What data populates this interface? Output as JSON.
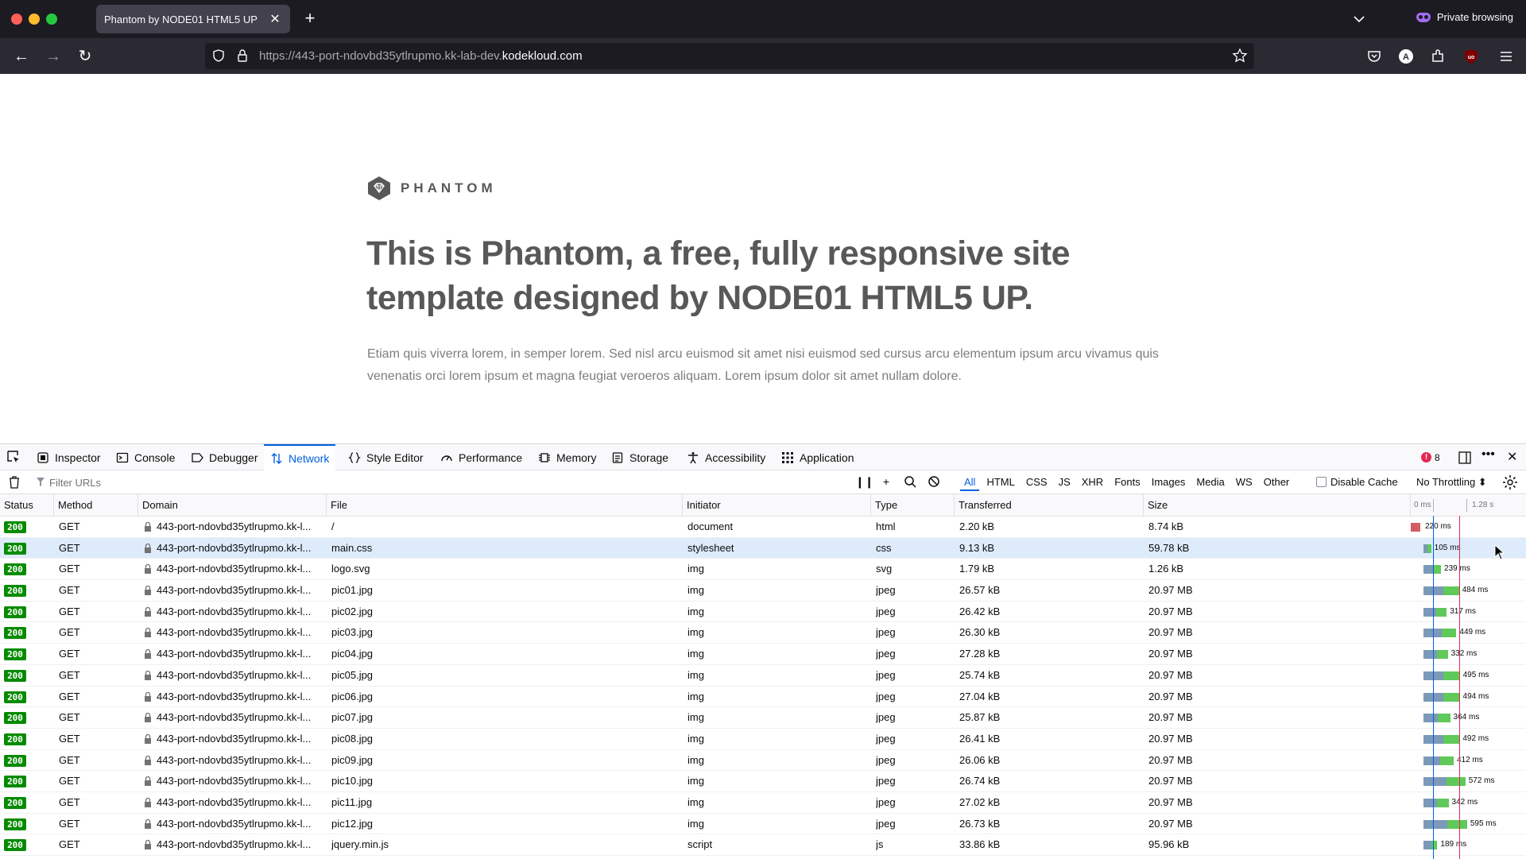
{
  "browser": {
    "tab_title": "Phantom by NODE01 HTML5 UP",
    "url_prefix": "https://443-port-ndovbd35ytlrupmo.kk-lab-dev.",
    "url_host": "kodekloud.com",
    "private_label": "Private browsing"
  },
  "page": {
    "logo_text": "PHANTOM",
    "headline": "This is Phantom, a free, fully responsive site template designed by NODE01 HTML5 UP.",
    "paragraph": "Etiam quis viverra lorem, in semper lorem. Sed nisl arcu euismod sit amet nisi euismod sed cursus arcu elementum ipsum arcu vivamus quis venenatis orci lorem ipsum et magna feugiat veroeros aliquam. Lorem ipsum dolor sit amet nullam dolore."
  },
  "devtools": {
    "tabs": [
      {
        "label": "Inspector",
        "icon": "inspector-icon"
      },
      {
        "label": "Console",
        "icon": "console-icon"
      },
      {
        "label": "Debugger",
        "icon": "debugger-icon"
      },
      {
        "label": "Network",
        "icon": "network-icon",
        "active": true
      },
      {
        "label": "Style Editor",
        "icon": "style-editor-icon"
      },
      {
        "label": "Performance",
        "icon": "performance-icon"
      },
      {
        "label": "Memory",
        "icon": "memory-icon"
      },
      {
        "label": "Storage",
        "icon": "storage-icon"
      },
      {
        "label": "Accessibility",
        "icon": "accessibility-icon"
      },
      {
        "label": "Application",
        "icon": "application-icon"
      }
    ],
    "error_count": "8",
    "filter_placeholder": "Filter URLs",
    "type_filters": [
      "All",
      "HTML",
      "CSS",
      "JS",
      "XHR",
      "Fonts",
      "Images",
      "Media",
      "WS",
      "Other"
    ],
    "active_type_filter": "All",
    "disable_cache_label": "Disable Cache",
    "throttling_label": "No Throttling ⬍",
    "columns": [
      "Status",
      "Method",
      "Domain",
      "File",
      "Initiator",
      "Type",
      "Transferred",
      "Size"
    ],
    "timeline_labels": [
      "0 ms",
      "1.28 s"
    ],
    "requests": [
      {
        "status": "200",
        "method": "GET",
        "domain": "443-port-ndovbd35ytlrupmo.kk-l...",
        "file": "/",
        "initiator": "document",
        "type": "html",
        "transferred": "2.20 kB",
        "size": "8.74 kB",
        "time": "220 ms"
      },
      {
        "status": "200",
        "method": "GET",
        "domain": "443-port-ndovbd35ytlrupmo.kk-l...",
        "file": "main.css",
        "initiator": "stylesheet",
        "type": "css",
        "transferred": "9.13 kB",
        "size": "59.78 kB",
        "time": "105 ms",
        "selected": true
      },
      {
        "status": "200",
        "method": "GET",
        "domain": "443-port-ndovbd35ytlrupmo.kk-l...",
        "file": "logo.svg",
        "initiator": "img",
        "type": "svg",
        "transferred": "1.79 kB",
        "size": "1.26 kB",
        "time": "239 ms"
      },
      {
        "status": "200",
        "method": "GET",
        "domain": "443-port-ndovbd35ytlrupmo.kk-l...",
        "file": "pic01.jpg",
        "initiator": "img",
        "type": "jpeg",
        "transferred": "26.57 kB",
        "size": "20.97 MB",
        "time": "484 ms"
      },
      {
        "status": "200",
        "method": "GET",
        "domain": "443-port-ndovbd35ytlrupmo.kk-l...",
        "file": "pic02.jpg",
        "initiator": "img",
        "type": "jpeg",
        "transferred": "26.42 kB",
        "size": "20.97 MB",
        "time": "317 ms"
      },
      {
        "status": "200",
        "method": "GET",
        "domain": "443-port-ndovbd35ytlrupmo.kk-l...",
        "file": "pic03.jpg",
        "initiator": "img",
        "type": "jpeg",
        "transferred": "26.30 kB",
        "size": "20.97 MB",
        "time": "449 ms"
      },
      {
        "status": "200",
        "method": "GET",
        "domain": "443-port-ndovbd35ytlrupmo.kk-l...",
        "file": "pic04.jpg",
        "initiator": "img",
        "type": "jpeg",
        "transferred": "27.28 kB",
        "size": "20.97 MB",
        "time": "332 ms"
      },
      {
        "status": "200",
        "method": "GET",
        "domain": "443-port-ndovbd35ytlrupmo.kk-l...",
        "file": "pic05.jpg",
        "initiator": "img",
        "type": "jpeg",
        "transferred": "25.74 kB",
        "size": "20.97 MB",
        "time": "495 ms"
      },
      {
        "status": "200",
        "method": "GET",
        "domain": "443-port-ndovbd35ytlrupmo.kk-l...",
        "file": "pic06.jpg",
        "initiator": "img",
        "type": "jpeg",
        "transferred": "27.04 kB",
        "size": "20.97 MB",
        "time": "494 ms"
      },
      {
        "status": "200",
        "method": "GET",
        "domain": "443-port-ndovbd35ytlrupmo.kk-l...",
        "file": "pic07.jpg",
        "initiator": "img",
        "type": "jpeg",
        "transferred": "25.87 kB",
        "size": "20.97 MB",
        "time": "364 ms"
      },
      {
        "status": "200",
        "method": "GET",
        "domain": "443-port-ndovbd35ytlrupmo.kk-l...",
        "file": "pic08.jpg",
        "initiator": "img",
        "type": "jpeg",
        "transferred": "26.41 kB",
        "size": "20.97 MB",
        "time": "492 ms"
      },
      {
        "status": "200",
        "method": "GET",
        "domain": "443-port-ndovbd35ytlrupmo.kk-l...",
        "file": "pic09.jpg",
        "initiator": "img",
        "type": "jpeg",
        "transferred": "26.06 kB",
        "size": "20.97 MB",
        "time": "412 ms"
      },
      {
        "status": "200",
        "method": "GET",
        "domain": "443-port-ndovbd35ytlrupmo.kk-l...",
        "file": "pic10.jpg",
        "initiator": "img",
        "type": "jpeg",
        "transferred": "26.74 kB",
        "size": "20.97 MB",
        "time": "572 ms"
      },
      {
        "status": "200",
        "method": "GET",
        "domain": "443-port-ndovbd35ytlrupmo.kk-l...",
        "file": "pic11.jpg",
        "initiator": "img",
        "type": "jpeg",
        "transferred": "27.02 kB",
        "size": "20.97 MB",
        "time": "342 ms"
      },
      {
        "status": "200",
        "method": "GET",
        "domain": "443-port-ndovbd35ytlrupmo.kk-l...",
        "file": "pic12.jpg",
        "initiator": "img",
        "type": "jpeg",
        "transferred": "26.73 kB",
        "size": "20.97 MB",
        "time": "595 ms"
      },
      {
        "status": "200",
        "method": "GET",
        "domain": "443-port-ndovbd35ytlrupmo.kk-l...",
        "file": "jquery.min.js",
        "initiator": "script",
        "type": "js",
        "transferred": "33.86 kB",
        "size": "95.96 kB",
        "time": "189 ms"
      }
    ]
  }
}
